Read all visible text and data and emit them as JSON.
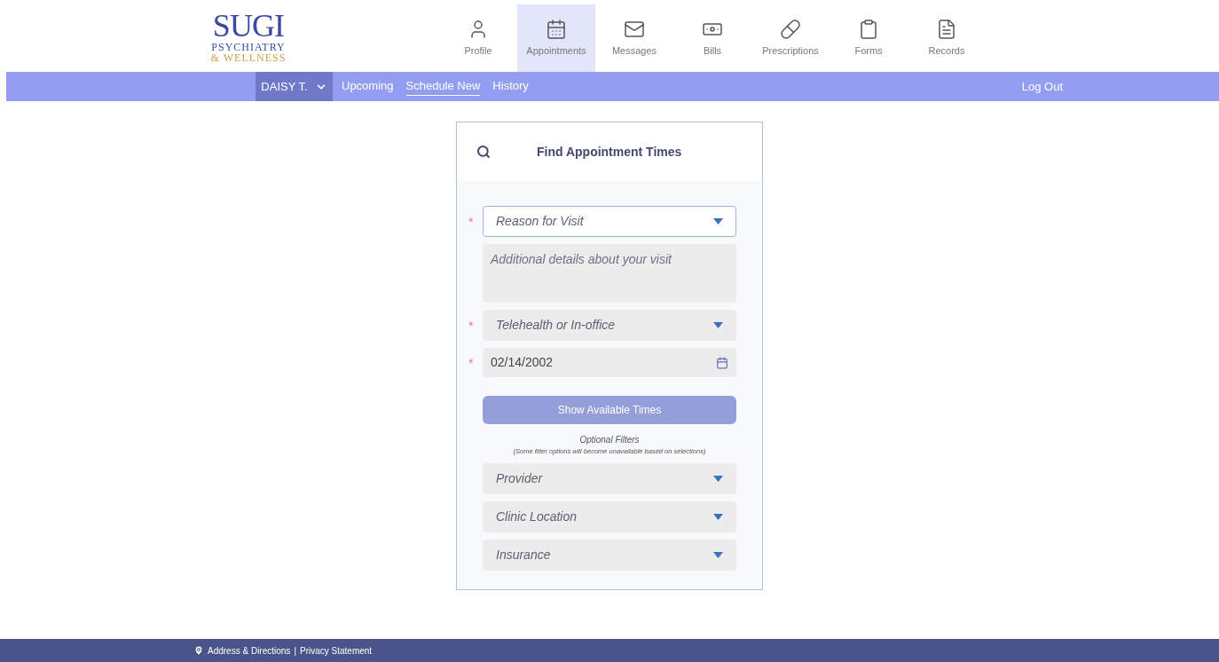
{
  "logo": {
    "wordmark": "SUGI",
    "line_1": "PSYCHIATRY",
    "line_2": "& WELLNESS"
  },
  "nav": [
    {
      "label": "Profile",
      "kind": "person",
      "selected": false
    },
    {
      "label": "Appointments",
      "kind": "calendar",
      "selected": true
    },
    {
      "label": "Messages",
      "kind": "envelope",
      "selected": false
    },
    {
      "label": "Bills",
      "kind": "bill",
      "selected": false
    },
    {
      "label": "Prescriptions",
      "kind": "pill",
      "selected": false
    },
    {
      "label": "Forms",
      "kind": "clipboard",
      "selected": false
    },
    {
      "label": "Records",
      "kind": "document",
      "selected": false
    }
  ],
  "subnav": {
    "user": "DAISY T.",
    "links": [
      {
        "label": "Upcoming",
        "selected": false
      },
      {
        "label": "Schedule New",
        "selected": true
      },
      {
        "label": "History",
        "selected": false
      }
    ],
    "logout": "Log Out"
  },
  "card": {
    "title": "Find Appointment Times",
    "fields": [
      {
        "kind": "select",
        "placeholder": "Reason for Visit",
        "required_mark": "*",
        "focused": true
      },
      {
        "kind": "textarea",
        "placeholder": "Additional details about your visit",
        "focused": false
      },
      {
        "kind": "select",
        "placeholder": "Telehealth or In-office",
        "required_mark": "*",
        "focused": false
      },
      {
        "kind": "date",
        "value": "02/14/2002",
        "required_mark": "*",
        "focused": false
      }
    ],
    "button": "Show Available Times",
    "filters_title": "Optional Filters",
    "filters_note": "(Some filter options will become unavailable based on selections)",
    "filters": [
      {
        "kind": "select",
        "placeholder": "Provider",
        "focused": false
      },
      {
        "kind": "select",
        "placeholder": "Clinic Location",
        "focused": false
      },
      {
        "kind": "select",
        "placeholder": "Insurance",
        "focused": false
      }
    ]
  },
  "footer": {
    "links": [
      {
        "label": "Address & Directions"
      },
      {
        "label": "Privacy Statement"
      }
    ],
    "separator": "|"
  }
}
